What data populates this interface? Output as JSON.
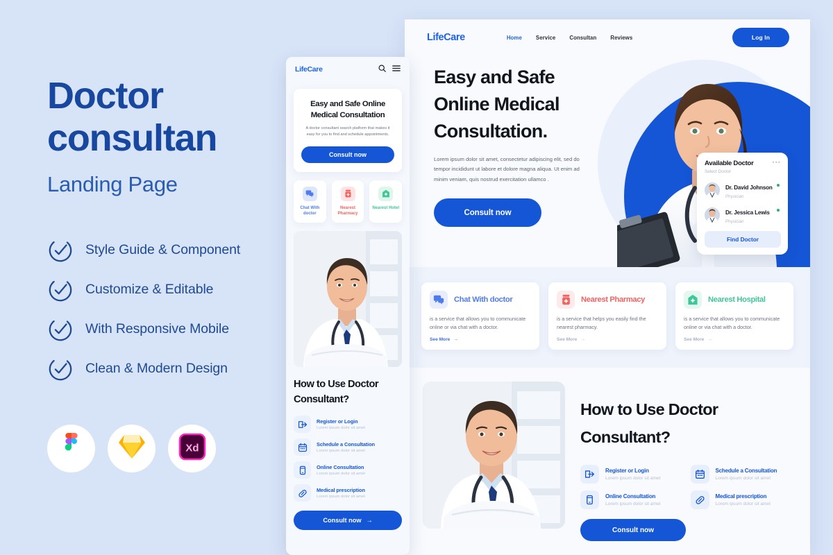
{
  "promo": {
    "title_line1": "Doctor",
    "title_line2": "consultan",
    "subtitle": "Landing Page",
    "features": [
      {
        "label": "Style Guide & Component",
        "icon": "check-circle-icon"
      },
      {
        "label": "Customize & Editable",
        "icon": "check-circle-icon"
      },
      {
        "label": "With Responsive Mobile",
        "icon": "check-circle-icon"
      },
      {
        "label": "Clean & Modern Design",
        "icon": "check-circle-icon"
      }
    ],
    "tools": [
      {
        "name": "Figma",
        "icon": "figma-icon"
      },
      {
        "name": "Sketch",
        "icon": "sketch-icon"
      },
      {
        "name": "Adobe XD",
        "icon": "adobe-xd-icon"
      }
    ]
  },
  "colors": {
    "page_background": "#d7e3f7",
    "brand_blue": "#1556d6",
    "title_blue": "#17479e",
    "subtitle_blue": "#2a5db0",
    "chat_blue": "#4f7ced",
    "pharmacy_red": "#f4615f",
    "hospital_green": "#3fc79a",
    "status_green": "#22b573"
  },
  "desktop": {
    "logo": "LifeCare",
    "nav_links": [
      {
        "label": "Home",
        "active": true
      },
      {
        "label": "Service",
        "active": false
      },
      {
        "label": "Consultan",
        "active": false
      },
      {
        "label": "Reviews",
        "active": false
      }
    ],
    "login_label": "Log In",
    "hero": {
      "title_line1": "Easy and Safe",
      "title_line2": "Online Medical",
      "title_line3": "Consultation.",
      "paragraph": "Lorem ipsum dolor sit amet, consectetur adipiscing elit, sed do tempor incididunt ut labore et dolore magna aliqua. Ut enim ad minim veniam, quis nostrud exercitation ullamco .",
      "cta_label": "Consult now"
    },
    "available_doctor": {
      "title": "Available Doctor",
      "subtitle": "Select Doctor",
      "menu_icon": "ellipsis-icon",
      "doctors": [
        {
          "name": "Dr. David Johnson",
          "role": "Physician",
          "online": true
        },
        {
          "name": "Dr. Jessica Lewis",
          "role": "Physician",
          "online": true
        }
      ],
      "button_label": "Find Doctor"
    },
    "services": [
      {
        "title": "Chat With doctor",
        "description": "is a service that allows you to communicate online or via chat with a doctor.",
        "link_label": "See More",
        "icon": "chat-bubble-icon",
        "color": "#4f7ced",
        "bg": "#e7edfd"
      },
      {
        "title": "Nearest Pharmacy",
        "description": "is a service that helps you easily find the nearest pharmacy.",
        "link_label": "See More",
        "icon": "medicine-jar-icon",
        "color": "#f4615f",
        "bg": "#fdeaea"
      },
      {
        "title": "Nearest Hospital",
        "description": "is a service that allows you to communicate online or via chat with a doctor.",
        "link_label": "See More",
        "icon": "hospital-icon",
        "color": "#3fc79a",
        "bg": "#e4f8f0"
      }
    ],
    "howto": {
      "title_line1": "How to Use Doctor",
      "title_line2": "Consultant?",
      "steps": [
        {
          "title": "Register or Login",
          "description": "Lorem ipsum dolor sit amet",
          "icon": "login-arrow-icon"
        },
        {
          "title": "Schedule a Consultation",
          "description": "Lorem ipsum dolor sit amet",
          "icon": "calendar-icon"
        },
        {
          "title": "Online Consultation",
          "description": "Lorem ipsum dolor sit amet",
          "icon": "mobile-phone-icon"
        },
        {
          "title": "Medical prescription",
          "description": "Lorem ipsum dolor sit amet",
          "icon": "pill-icon"
        }
      ],
      "cta_label": "Consult now"
    }
  },
  "mobile": {
    "logo": "LifeCare",
    "search_icon": "search-icon",
    "menu_icon": "hamburger-menu-icon",
    "hero": {
      "title": "Easy and Safe Online Medical Consultation",
      "description": "A doctor consultant search platform that makes it easy for you to find and schedule appointments.",
      "cta_label": "Consult now"
    },
    "chips": [
      {
        "label": "Chat With doctor",
        "icon": "chat-bubble-icon",
        "color": "#4f7ced",
        "bg": "#dde6fc"
      },
      {
        "label": "Nearest Pharmacy",
        "icon": "medicine-jar-icon",
        "color": "#f4615f",
        "bg": "#fde3e3"
      },
      {
        "label": "Nearest Hotel",
        "icon": "hospital-icon",
        "color": "#3fc79a",
        "bg": "#dff6ed"
      }
    ],
    "howto": {
      "title_line1": "How to Use Doctor",
      "title_line2": "Consultant?",
      "steps": [
        {
          "title": "Register or Login",
          "description": "Lorem ipsum dolor sit amet",
          "icon": "login-arrow-icon"
        },
        {
          "title": "Schedule a Consultation",
          "description": "Lorem ipsum dolor sit amet",
          "icon": "calendar-icon"
        },
        {
          "title": "Online Consultation",
          "description": "Lorem ipsum dolor sit amet",
          "icon": "mobile-phone-icon"
        },
        {
          "title": "Medical prescription",
          "description": "Lorem ipsum dolor sit amet",
          "icon": "pill-icon"
        }
      ],
      "cta_label": "Consult now"
    }
  }
}
